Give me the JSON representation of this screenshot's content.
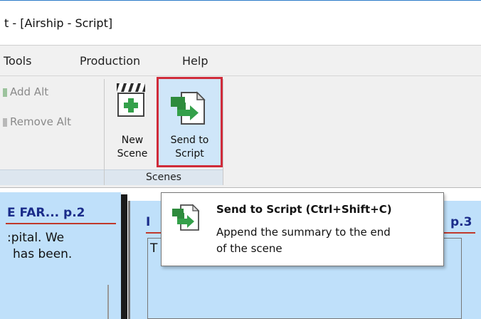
{
  "window": {
    "title": "t - [Airship - Script]"
  },
  "menu": {
    "items": [
      "Tools",
      "Production",
      "Help"
    ]
  },
  "ribbon": {
    "alts": {
      "add_label": "Add Alt",
      "remove_label": "Remove Alt"
    },
    "scenes": {
      "new_scene_line1": "New",
      "new_scene_line2": "Scene",
      "send_line1": "Send to",
      "send_line2": "Script",
      "group_label": "Scenes"
    }
  },
  "cards": {
    "left": {
      "title": "E FAR... p.2",
      "line1": ":pital. We",
      "line2": "has been."
    },
    "right": {
      "title_start": "I",
      "title_end": "p.3",
      "body_start": "T"
    }
  },
  "tooltip": {
    "title": "Send to Script (Ctrl+Shift+C)",
    "line1": "Append the summary to the end",
    "line2": "of the scene"
  },
  "colors": {
    "accent_highlight": "#d02c3a",
    "card_bg": "#bfe0fa",
    "title_blue": "#1a2c8a",
    "icon_green": "#34a04a"
  },
  "icons": [
    "add-alt-icon",
    "remove-alt-icon",
    "new-scene-icon",
    "send-to-script-icon"
  ]
}
